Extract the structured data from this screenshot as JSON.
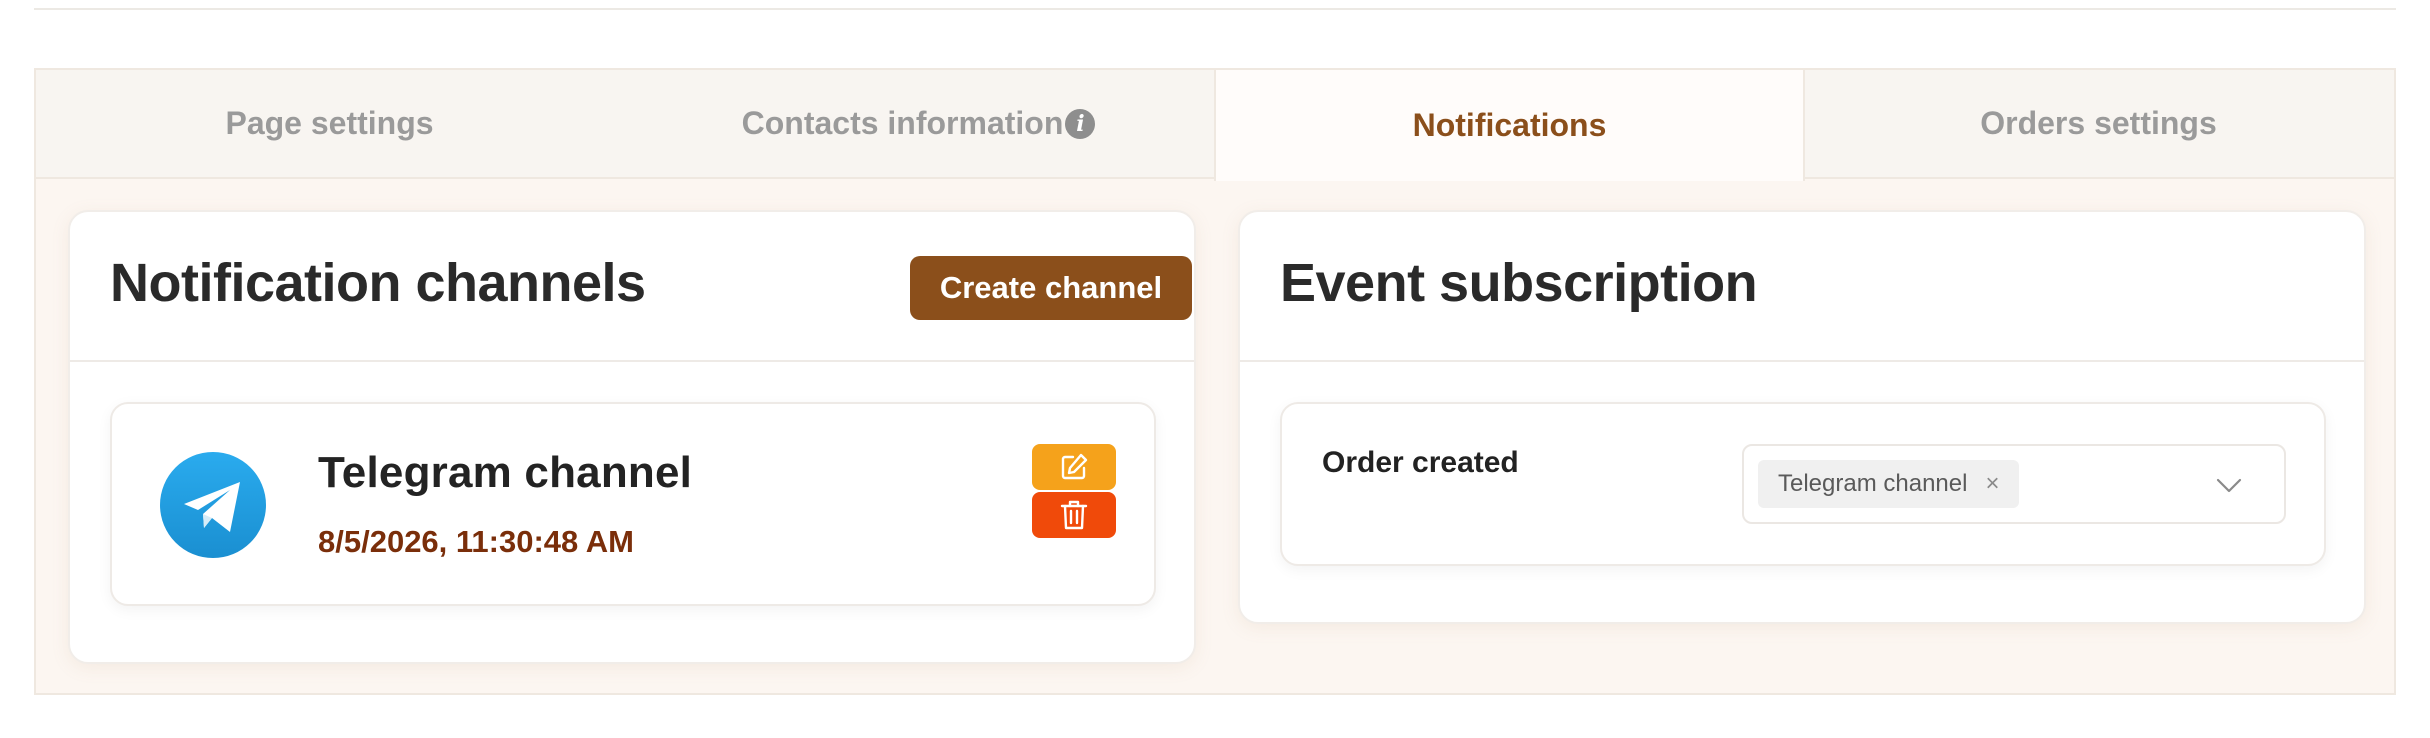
{
  "tabs": [
    {
      "label": "Page settings",
      "active": false
    },
    {
      "label": "Contacts information",
      "active": false,
      "icon": "info-icon"
    },
    {
      "label": "Notifications",
      "active": true
    },
    {
      "label": "Orders settings",
      "active": false
    }
  ],
  "info_icon_glyph": "i",
  "notification_channels": {
    "title": "Notification channels",
    "create_button_label": "Create channel",
    "channels": [
      {
        "name": "Telegram channel",
        "date": "8/5/2026, 11:30:48 AM",
        "icon": "telegram-icon"
      }
    ]
  },
  "event_subscription": {
    "title": "Event subscription",
    "events": [
      {
        "label": "Order created",
        "selected_tags": [
          "Telegram channel"
        ],
        "tag_remove_glyph": "×"
      }
    ]
  },
  "colors": {
    "accent": "#8b4f1b",
    "edit": "#f5a21b",
    "delete": "#f04a0a",
    "date_text": "#7a2e0a",
    "telegram": "#229ed9"
  }
}
